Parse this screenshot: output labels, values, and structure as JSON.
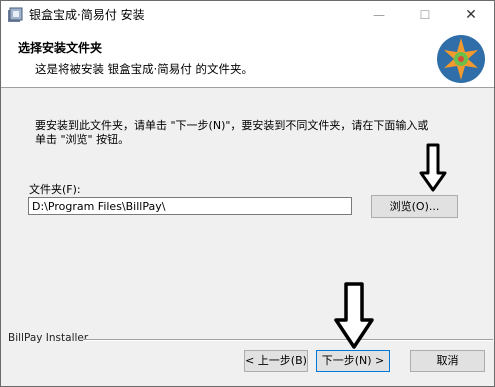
{
  "window": {
    "title": "银盒宝成·简易付 安装"
  },
  "titlebar": {
    "minimize": "—",
    "maximize": "☐",
    "close": "✕"
  },
  "header": {
    "title": "选择安装文件夹",
    "subtitle": "这是将被安装 银盒宝成·简易付 的文件夹。"
  },
  "body": {
    "instructions": "要安装到此文件夹，请单击 \"下一步(N)\"，要安装到不同文件夹，请在下面输入或\n单击 \"浏览\" 按钮。",
    "folder_label": "文件夹(F):",
    "folder_value": "D:\\Program Files\\BillPay\\",
    "browse_label": "浏览(O)..."
  },
  "footer": {
    "installer_label": "BillPay Installer",
    "back_label": "< 上一步(B)",
    "next_label": "下一步(N) >",
    "cancel_label": "取消"
  },
  "colors": {
    "focus_border": "#0078d7",
    "button_bg": "#e1e1e1",
    "window_bg": "#f0f0f0"
  }
}
